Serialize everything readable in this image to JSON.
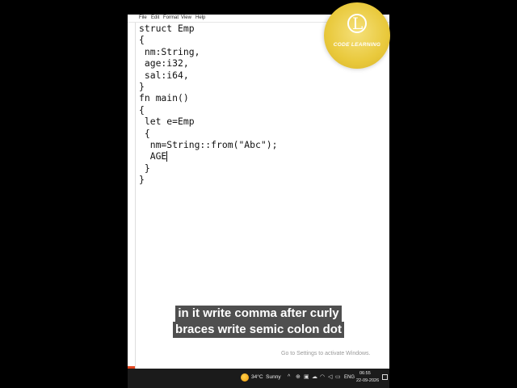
{
  "menu": [
    "File",
    "Edit",
    "Format",
    "View",
    "Help"
  ],
  "code": [
    "struct Emp",
    "{",
    " nm:String,",
    " age:i32,",
    " sal:i64,",
    "}",
    "fn main()",
    "{",
    " let e=Emp",
    " {",
    "  nm=String::from(\"Abc\");",
    "  AGE",
    " }",
    "}"
  ],
  "watermark": "Go to Settings to activate Windows.",
  "taskbar": {
    "weather": "34°C  Sunny",
    "language": "ENG",
    "time": "06:55",
    "date": "22-09-2026"
  },
  "logo": {
    "letter": "L",
    "text": "CODE LEARNING"
  },
  "caption": {
    "line1": "in it write comma after curly",
    "line2": "braces write semic colon dot"
  },
  "colors": {
    "logo_gold": "#e9c93c",
    "gutter_accent": "#e2461f",
    "taskbar": "#1b1b1b"
  }
}
